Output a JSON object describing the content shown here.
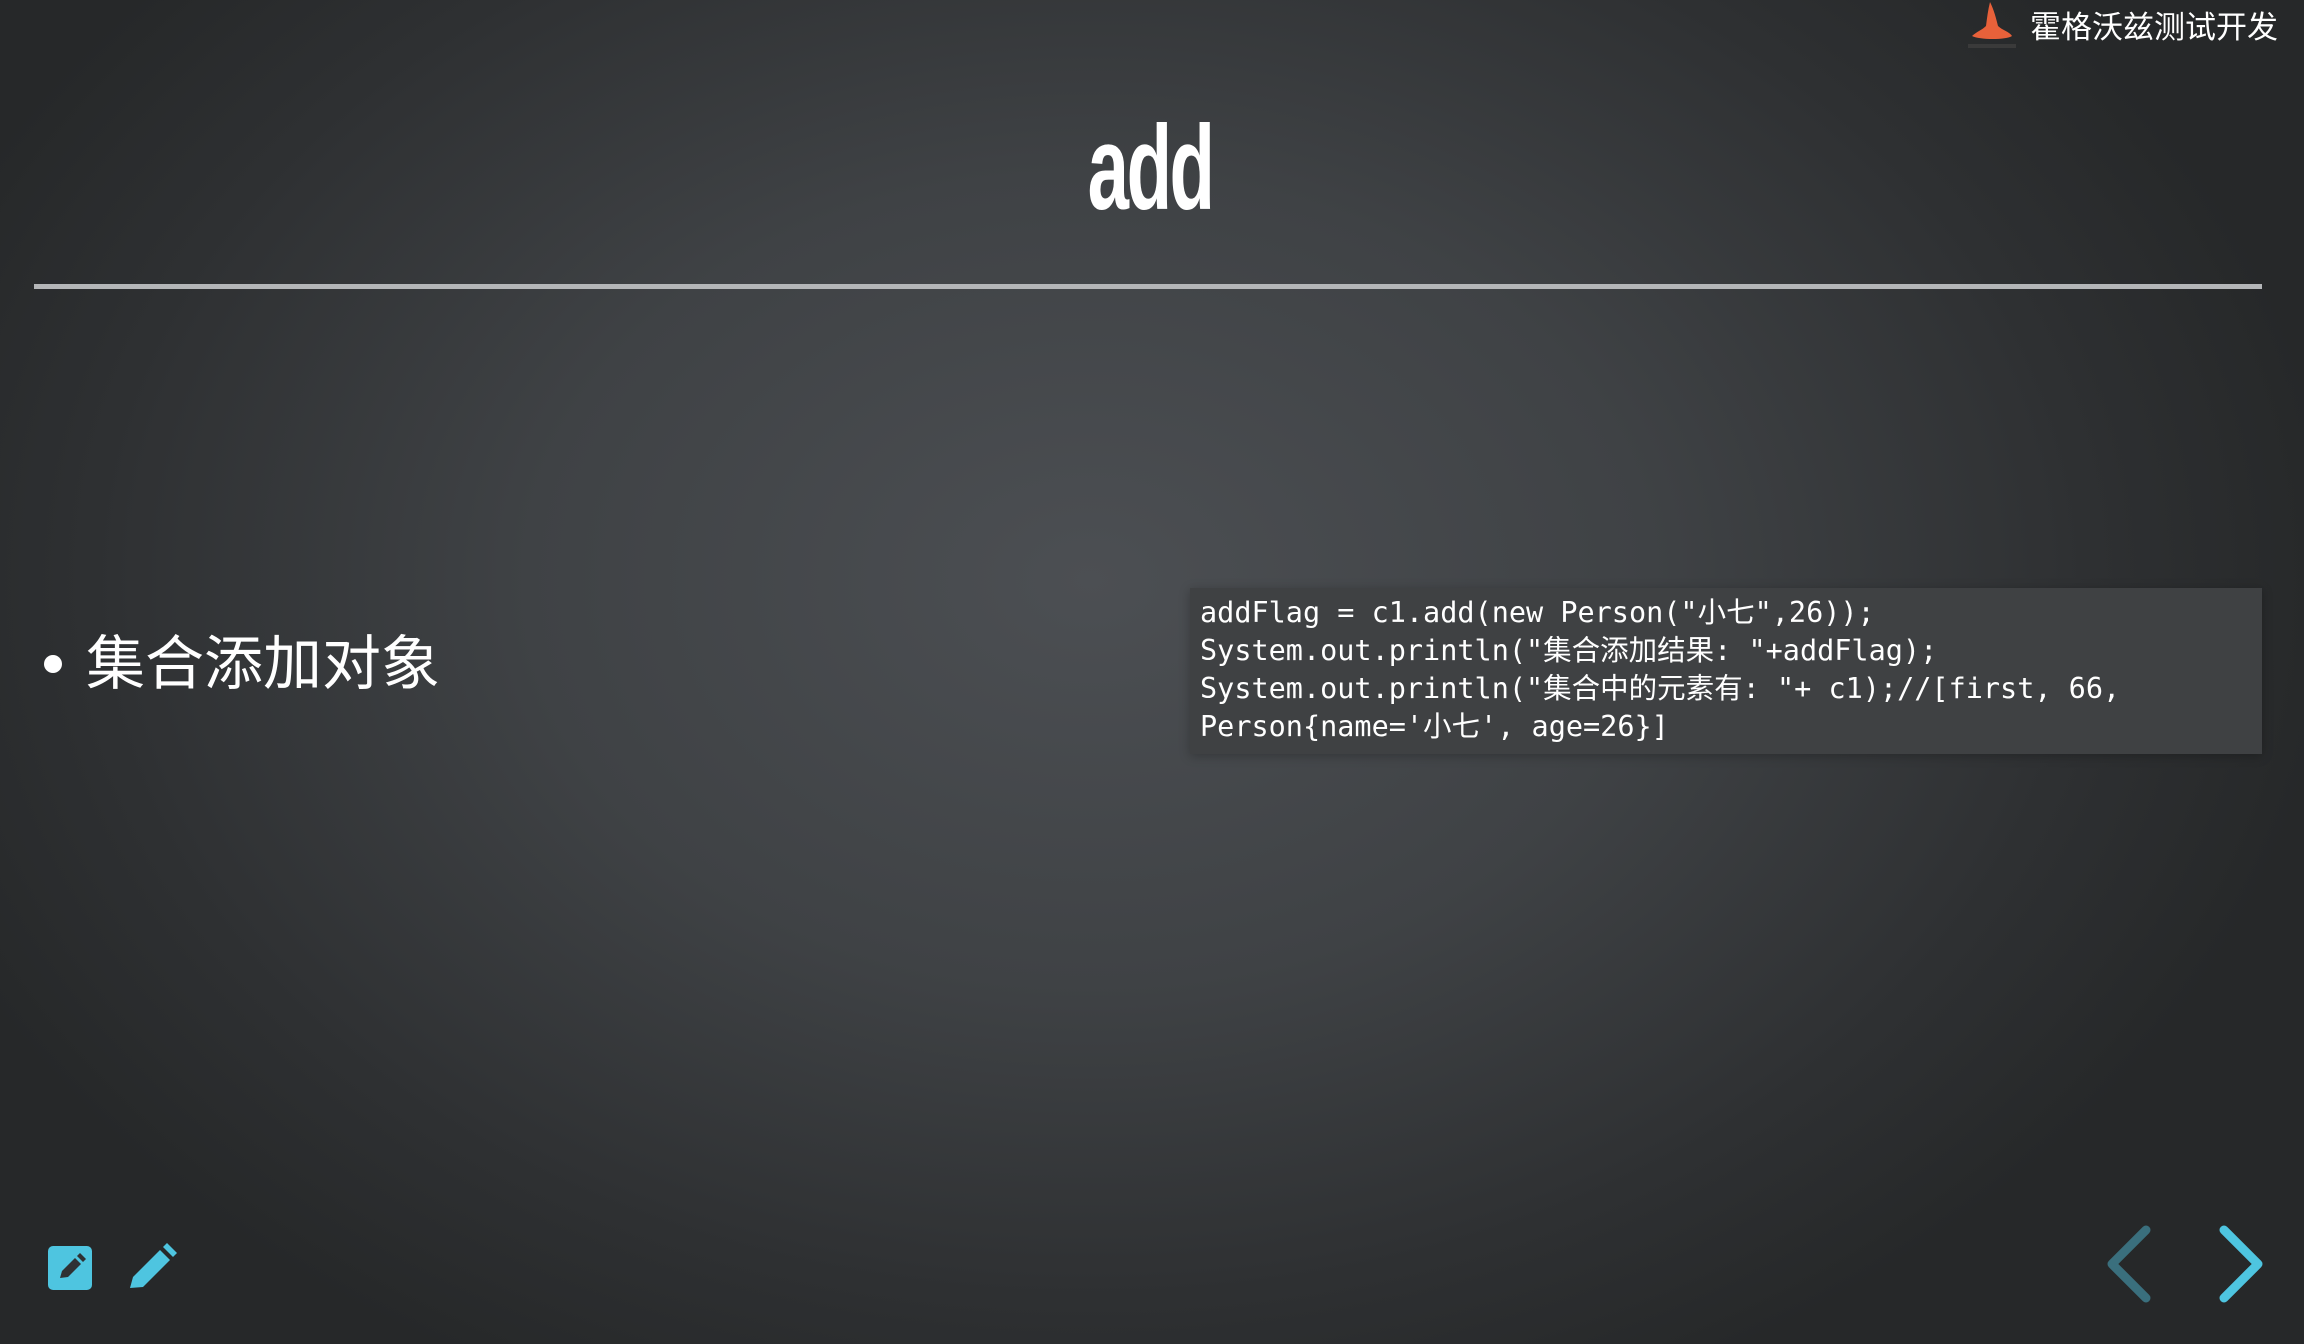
{
  "brand": {
    "text": "霍格沃兹测试开发",
    "logo_icon": "wizard-hat-icon"
  },
  "slide": {
    "title": "add",
    "bullets": [
      "集合添加对象"
    ],
    "code_lines": [
      "addFlag = c1.add(new Person(\"小七\",26));",
      "System.out.println(\"集合添加结果: \"+addFlag);",
      "System.out.println(\"集合中的元素有: \"+ c1);//[first, 66,",
      "Person{name='小七', age=26}]"
    ]
  },
  "toolbar": {
    "edit_icon": "edit-note-icon",
    "pen_icon": "pencil-icon"
  },
  "navigation": {
    "prev_icon": "chevron-left-icon",
    "next_icon": "chevron-right-icon"
  },
  "colors": {
    "accent": "#4ec5e0",
    "accent_dim": "#3a6f7d",
    "logo_orange": "#e8613a",
    "rule": "#b4b6b8"
  }
}
